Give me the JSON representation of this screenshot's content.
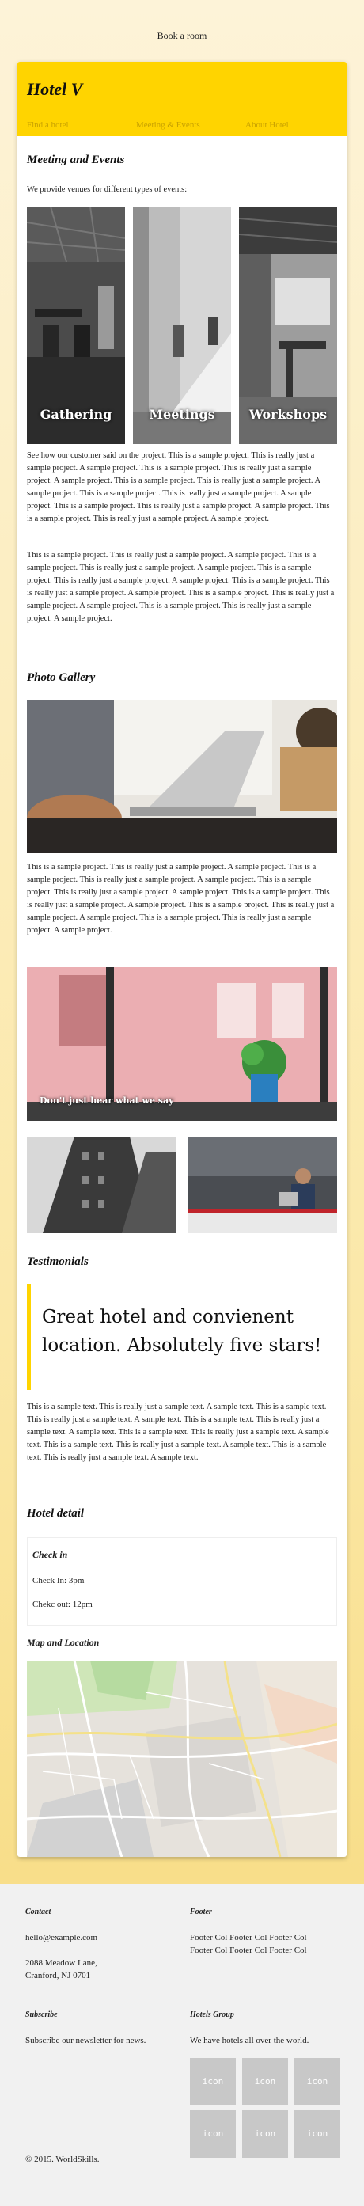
{
  "topbar": {
    "book_label": "Book a room"
  },
  "header": {
    "logo": "Hotel V",
    "nav": [
      "Find a hotel",
      "Meeting & Events",
      "About Hotel"
    ]
  },
  "meetings": {
    "title": "Meeting and Events",
    "intro": "We provide venues for different types of events:",
    "tiles": [
      "Gathering",
      "Meetings",
      "Workshops"
    ],
    "para1": "See how our customer said on the project. This is a sample project. This is really just a sample project. A sample project. This is a sample project. This is really just a sample project. A sample project. This is a sample project. This is really just a sample project. A sample project. This is a sample project. This is really just a sample project. A sample project. This is a sample project. This is really just a sample project. A sample project. This is a sample project. This is really just a sample project. A sample project.",
    "para2": "This is a sample project. This is really just a sample project. A sample project. This is a sample project. This is really just a sample project. A sample project. This is a sample project. This is really just a sample project. A sample project. This is a sample project. This is really just a sample project. A sample project. This is a sample project. This is really just a sample project. A sample project. This is a sample project. This is really just a sample project. A sample project."
  },
  "gallery": {
    "title": "Photo Gallery",
    "para": "This is a sample project. This is really just a sample project. A sample project. This is a sample project. This is really just a sample project. A sample project. This is a sample project. This is really just a sample project. A sample project. This is a sample project. This is really just a sample project. A sample project. This is a sample project. This is really just a sample project. A sample project. This is a sample project. This is really just a sample project. A sample project.",
    "caption": "Don't just hear what we say"
  },
  "testimonials": {
    "title": "Testimonials",
    "quote": "Great hotel and convienent location. Absolutely five stars!",
    "text": "This is a sample text. This is really just a sample text. A sample text. This is a sample text. This is really just a sample text. A sample text. This is a sample text. This is really just a sample text. A sample text. This is a sample text. This is really just a sample text. A sample text. This is a sample text. This is really just a sample text. A sample text. This is a sample text. This is really just a sample text. A sample text."
  },
  "hotel_detail": {
    "title": "Hotel detail",
    "check_in_title": "Check in",
    "check_in": "Check In: 3pm",
    "check_out": "Chekc out: 12pm",
    "map_title": "Map and Location"
  },
  "footer": {
    "contact_title": "Contact",
    "email": "hello@example.com",
    "address1": "2088 Meadow Lane,",
    "address2": "Cranford, NJ 0701",
    "footer_title": "Footer",
    "footer_cols1": "Footer Col Footer Col Footer Col",
    "footer_cols2": "Footer Col Footer Col Footer Col",
    "subscribe_title": "Subscribe",
    "subscribe_text": "Subscribe our newsletter for news.",
    "group_title": "Hotels Group",
    "group_text": "We have hotels all over the world.",
    "icon_label": "icon",
    "copyright": "© 2015. WorldSkills."
  },
  "colors": {
    "accent": "#ffd400",
    "nav_text": "#c9a200",
    "footer_bg": "#f1f1f1"
  }
}
